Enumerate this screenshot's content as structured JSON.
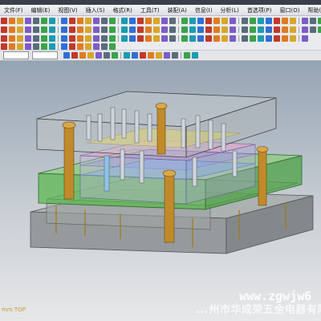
{
  "menu": {
    "items": [
      "文件(F)",
      "编辑(E)",
      "视图(V)",
      "插入(S)",
      "格式(R)",
      "工具(T)",
      "装配(A)",
      "信息(I)",
      "分析(L)",
      "首选项(P)",
      "窗口(O)",
      "帮助(H)"
    ]
  },
  "toolbar": {
    "icon_colors": [
      "#2f6fd6",
      "#d9a62a",
      "#3aa34a",
      "#c0392b",
      "#7d5cc6",
      "#1d9bb0",
      "#e07b23",
      "#5a6b7c"
    ]
  },
  "viewport": {
    "status_text": "mm TOP",
    "watermark_text": "...州市华成荣五金电器有限公司",
    "watermark_url": "www.zgwjw6"
  },
  "colors": {
    "plate_gray": "#8f9496",
    "plate_green": "#55b84a",
    "pillar_bronze": "#c08a2a",
    "accent_yellow": "#e8d84a"
  }
}
